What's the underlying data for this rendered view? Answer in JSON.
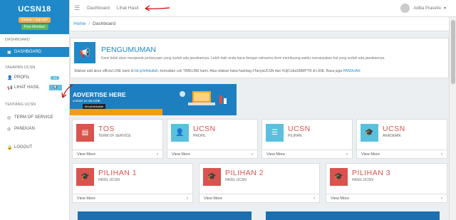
{
  "brand": {
    "name": "UCSN18",
    "upgrade": "Silakan Upgrade!",
    "plan": "Free Member"
  },
  "sidebar": {
    "dashboard_section": "DASHBOARD",
    "dashboard_item": "DASHBOARD",
    "tahapan_section": "TAHAPAN UCSN",
    "profil": "PROFIL",
    "profil_badge": "0/3",
    "lihat_hasil": "LIHAT HASIL",
    "tentang_section": "TENTANG UCSN",
    "term": "TERM OF SERVICE",
    "panduan": "PANDUAN",
    "logout": "LOGOUT"
  },
  "topbar": {
    "dashboard": "Dashboard",
    "lihat_hasil": "Lihat Hasil",
    "user": "Adlita Prasetio"
  },
  "breadcrumb": {
    "home": "Home",
    "current": "Dashboard"
  },
  "announcement": {
    "title": "PENGUMUMAN",
    "body": "Kami tidak akan menjawab pertanyaan yang sudah ada jawabannya. Lebih baik anda baca dengan seksama demi membuang waktu menanyakan hal yang sudah ada jawabannya.",
    "line2_a": "Silakan add akun official LINE kami di",
    "line2_link": "bit.ly/infokuliah",
    "line2_b": ", kemudian cek TIMELINE kami. Atau silakan buka hashtag #TanyaUCSN dan #UjiCobaSNMPTN di LINE. Baca juga",
    "line2_link2": "PANDUAN"
  },
  "banner": {
    "title": "ADVERTISE HERE",
    "sub": "contact us via LINE",
    "tag": "bit.ly/infokuliah"
  },
  "cards": [
    {
      "title": "TOS",
      "sub": "TERM OF SERVICE",
      "foot": "View More"
    },
    {
      "title": "UCSN",
      "sub": "PROFIL",
      "foot": "View More"
    },
    {
      "title": "UCSN",
      "sub": "PILIHAN",
      "foot": "View More"
    },
    {
      "title": "UCSN",
      "sub": "AKADEMIK",
      "foot": "View More"
    },
    {
      "title": "PILIHAN 1",
      "sub": "HASIL UCSN",
      "foot": "View More"
    },
    {
      "title": "PILIHAN 2",
      "sub": "HASIL UCSN",
      "foot": "View More"
    },
    {
      "title": "PILIHAN 3",
      "sub": "HASIL UCSN",
      "foot": "View More"
    }
  ],
  "colors": {
    "primary": "#1e88c8",
    "danger": "#d9534f",
    "info": "#5bc0de",
    "annotation": "#cc0000"
  }
}
